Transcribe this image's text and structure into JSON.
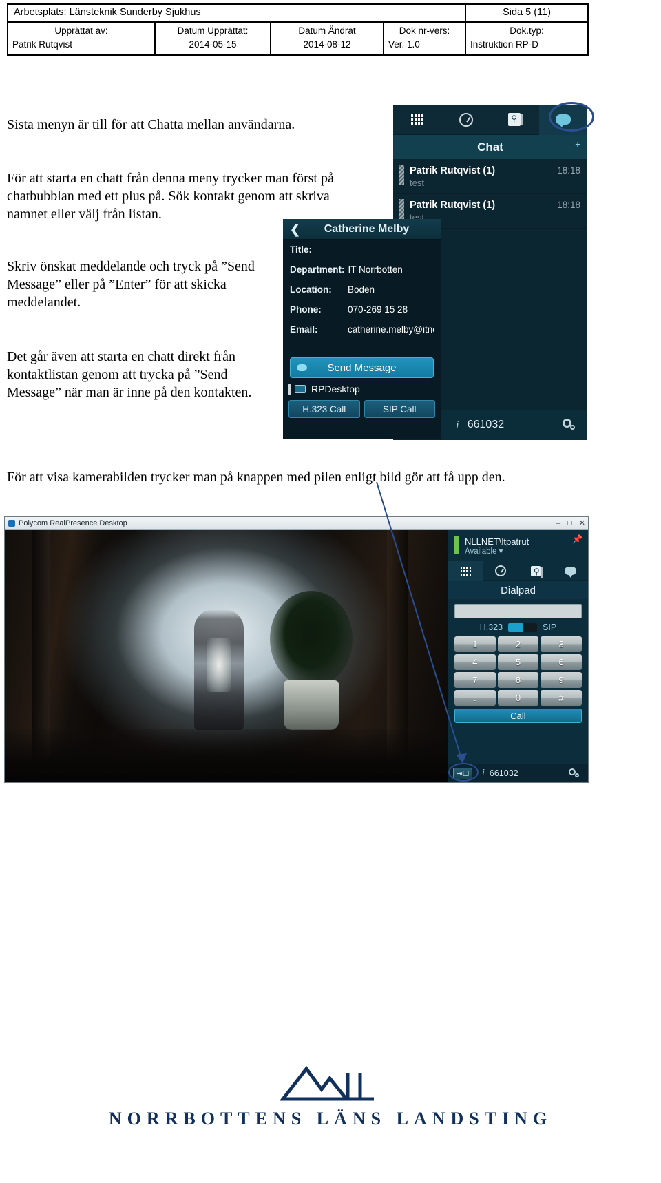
{
  "doc_header": {
    "workplace": "Arbetsplats: Länsteknik Sunderby Sjukhus",
    "page": "Sida 5 (11)",
    "created_by_label": "Upprättat av:",
    "created_by_value": "Patrik Rutqvist",
    "created_date_label": "Datum Upprättat:",
    "created_date_value": "2014-05-15",
    "changed_date_label": "Datum Ändrat",
    "changed_date_value": "2014-08-12",
    "doc_nr_label": "Dok nr-vers:",
    "doc_nr_value": "Ver. 1.0",
    "doc_type_label": "Dok.typ:",
    "doc_type_value": "Instruktion RP-D"
  },
  "body": {
    "p1": "Sista menyn är till för att Chatta mellan användarna.",
    "p2": "För att starta en chatt från denna meny trycker man först på chatbubblan med ett plus på. Sök kontakt genom att skriva namnet eller välj från listan.",
    "p3": "Skriv önskat meddelande och tryck på ”Send Message” eller på ”Enter” för att skicka meddelandet.",
    "p4": "Det går även att starta en chatt direkt från kontaktlistan genom att trycka på ”Send Message” när man är inne på den kontakten.",
    "p5": "För att visa kamerabilden trycker man på knappen med pilen enligt bild gör att få upp den."
  },
  "chat_panel": {
    "tabs": [
      {
        "name": "dialpad-tab",
        "icon": "grid-icon"
      },
      {
        "name": "recent-tab",
        "icon": "clock-icon"
      },
      {
        "name": "directory-tab",
        "icon": "address-book-icon"
      },
      {
        "name": "chat-tab",
        "icon": "chat-bubble-icon"
      }
    ],
    "title": "Chat",
    "new_chat_icon": "chat-bubble-plus-icon",
    "conversations": [
      {
        "name": "Patrik Rutqvist (1)",
        "snippet": "test",
        "time": "18:18"
      },
      {
        "name": "Patrik Rutqvist (1)",
        "snippet": "test",
        "time": "18:18"
      }
    ]
  },
  "contact_panel": {
    "back_icon": "chevron-left-icon",
    "name": "Catherine Melby",
    "fields": [
      {
        "label": "Title:",
        "value": ""
      },
      {
        "label": "Department:",
        "value": "IT Norrbotten"
      },
      {
        "label": "Location:",
        "value": "Boden"
      },
      {
        "label": "Phone:",
        "value": "070-269 15 28"
      },
      {
        "label": "Email:",
        "value": "catherine.melby@itnor"
      }
    ],
    "send_message": "Send Message",
    "device": "RPDesktop",
    "h323_call": "H.323 Call",
    "sip_call": "SIP Call"
  },
  "status_strip": {
    "info_icon": "info-icon",
    "number": "661032",
    "settings_icon": "gear-icon"
  },
  "polycom_window": {
    "title": "Polycom RealPresence Desktop",
    "app_icon": "polycom-logo-icon",
    "window_buttons": [
      "minimize-button",
      "maximize-button",
      "close-button"
    ],
    "pin_icon": "pin-icon",
    "user": "NLLNET\\ltpatrut",
    "presence": "Available",
    "presence_caret": "chevron-down-icon",
    "tabs": [
      {
        "name": "dialpad-tab",
        "icon": "grid-icon"
      },
      {
        "name": "recent-tab",
        "icon": "clock-icon"
      },
      {
        "name": "directory-tab",
        "icon": "address-book-icon"
      },
      {
        "name": "chat-tab",
        "icon": "chat-bubble-icon"
      }
    ],
    "panel_title": "Dialpad",
    "dial_input_value": "",
    "protocol_left": "H.323",
    "protocol_right": "SIP",
    "keys": [
      "1",
      "2",
      "3",
      "4",
      "5",
      "6",
      "7",
      "8",
      "9",
      ".",
      "0",
      "#"
    ],
    "call_button": "Call",
    "video_toggle_icon": "show-video-icon",
    "info_icon": "info-icon",
    "number": "661032",
    "settings_icon": "gear-icon"
  },
  "footer": {
    "logo_icon": "mountain-peaks-logo",
    "text": "NORRBOTTENS LÄNS LANDSTING"
  },
  "colors": {
    "panel_bg": "#0b2631",
    "panel_dark": "#081b24",
    "accent": "#1f8fb6",
    "annotation": "#2a4e8f",
    "presence_green": "#6ec24a",
    "footer_blue": "#12305c"
  }
}
